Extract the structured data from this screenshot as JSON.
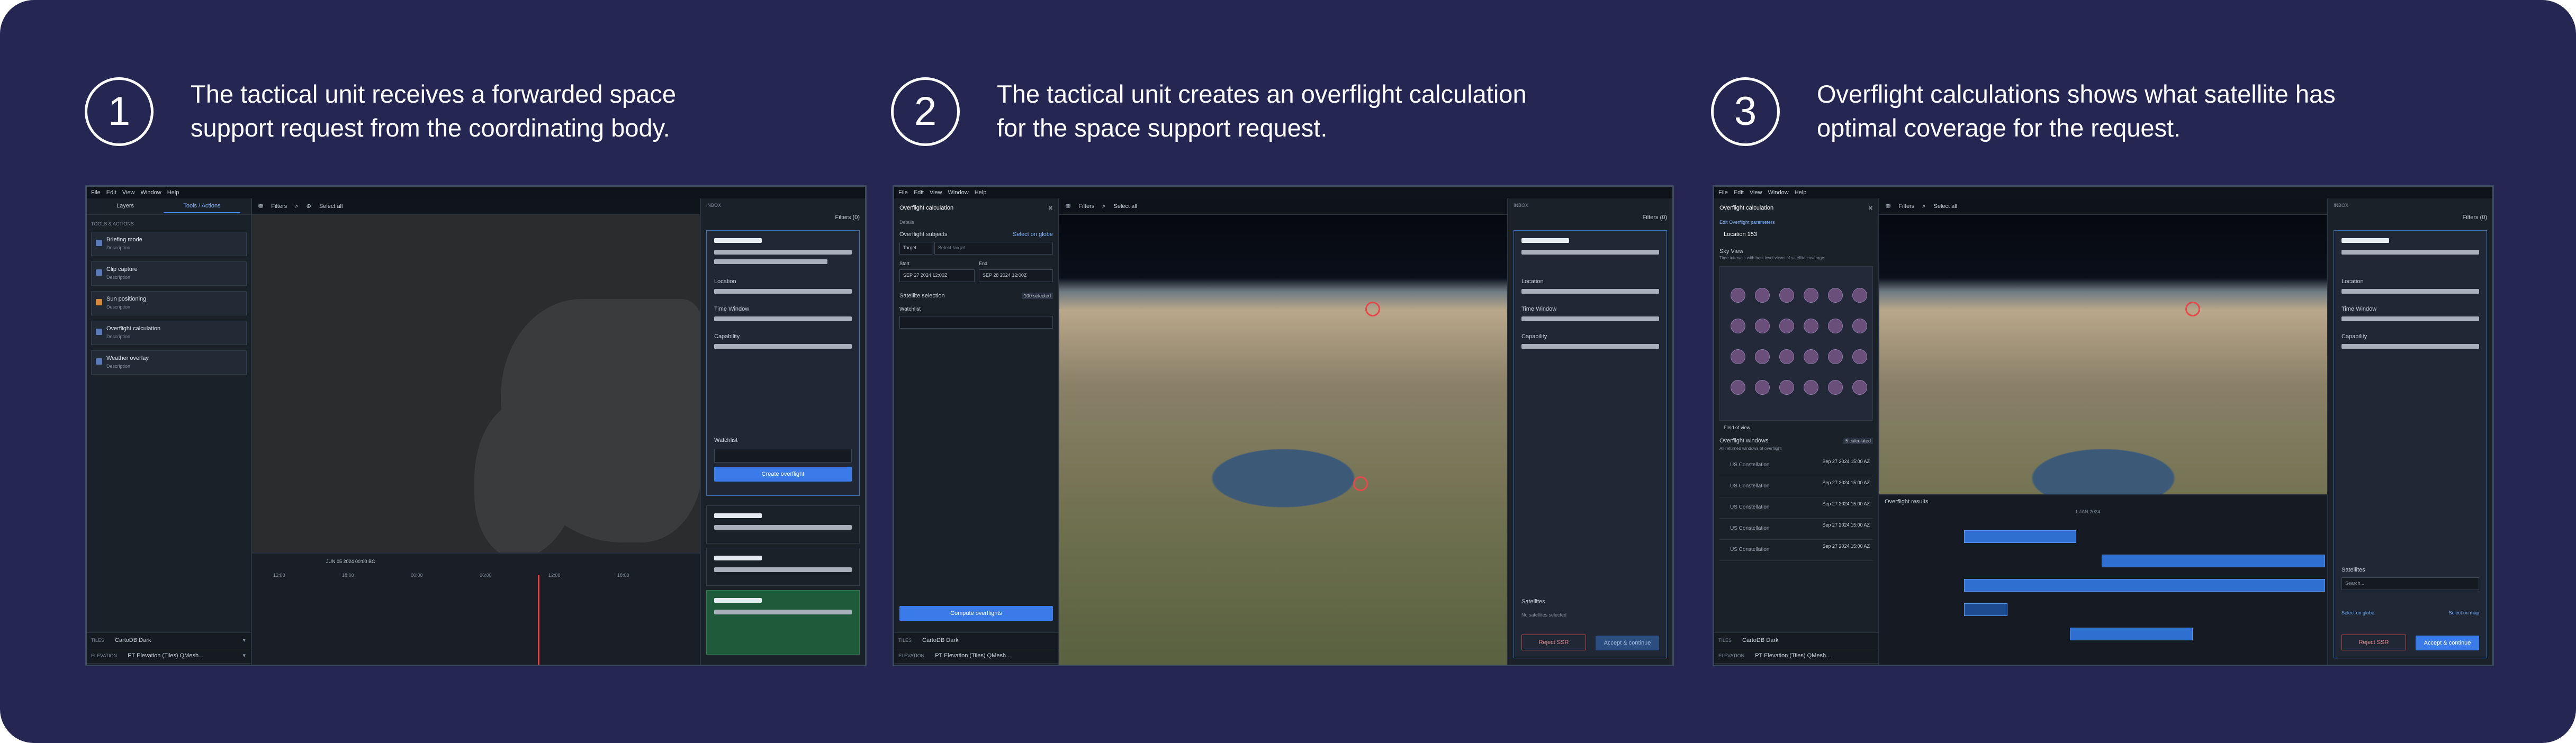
{
  "steps": [
    {
      "number": "1",
      "line1": "The tactical unit receives a forwarded space",
      "line2": "support request from the coordinating body."
    },
    {
      "number": "2",
      "line1": "The tactical unit creates an overflight calculation",
      "line2": "for the space support request."
    },
    {
      "number": "3",
      "line1": "Overflight calculations shows what satellite has",
      "line2": "optimal coverage for the request."
    }
  ],
  "menu": [
    "File",
    "Edit",
    "View",
    "Window",
    "Help"
  ],
  "panel_tabs": [
    "Layers",
    "Tools / Actions"
  ],
  "map_bar": {
    "filters": "Filters",
    "select_all": "Select all"
  },
  "tools_header": "TOOLS & ACTIONS",
  "tools": [
    {
      "title": "Briefing mode",
      "desc": "Description"
    },
    {
      "title": "Clip capture",
      "desc": "Description"
    },
    {
      "title": "Sun positioning",
      "desc": "Description"
    },
    {
      "title": "Overflight calculation",
      "desc": "Description"
    },
    {
      "title": "Weather overlay",
      "desc": "Description"
    }
  ],
  "footer": {
    "tiles_label": "TILES",
    "tiles_value": "CartoDB Dark",
    "elevation_label": "ELEVATION",
    "elevation_value": "PT Elevation (Tiles) QMesh..."
  },
  "right_panel": {
    "header": "INBOX",
    "filters": "Filters (0)",
    "location": "Location",
    "time_window": "Time Window",
    "capability": "Capability",
    "watchlist": "Watchlist",
    "create_overflight": "Create overflight",
    "satellites": "Satellites",
    "no_satellites": "No satellites selected",
    "search": "Search...",
    "select_on_globe": "Select on globe",
    "select_on_map": "Select on map",
    "reject": "Reject SSR",
    "accept": "Accept & continue"
  },
  "overflight_form": {
    "title": "Overflight calculation",
    "details": "Details",
    "subjects": "Overflight subjects",
    "select_on_globe": "Select on globe",
    "target": "Target",
    "select_target": "Select target",
    "start": "Start",
    "start_value": "SEP 27 2024 12:00Z",
    "end": "End",
    "end_value": "SEP 28 2024 12:00Z",
    "satellite_selection": "Satellite selection",
    "selected": "100 selected",
    "watchlist": "Watchlist",
    "compute": "Compute overflights"
  },
  "overflight_result": {
    "title": "Overflight calculation",
    "edit": "Edit Overflight parameters",
    "location": "Location 153",
    "sky_view": "Sky View",
    "sky_desc": "Time intervals with best level views of satellite coverage",
    "field_of_view": "Field of view",
    "windows": "Overflight windows",
    "windows_desc": "All returned windows of overflight",
    "windows_count": "5 calculated",
    "rows": [
      {
        "name": "US Constellation",
        "time": "Sep 27 2024 15:00 AZ"
      },
      {
        "name": "US Constellation",
        "time": "Sep 27 2024 15:00 AZ"
      },
      {
        "name": "US Constellation",
        "time": "Sep 27 2024 15:00 AZ"
      },
      {
        "name": "US Constellation",
        "time": "Sep 27 2024 15:00 AZ"
      },
      {
        "name": "US Constellation",
        "time": "Sep 27 2024 15:00 AZ"
      }
    ],
    "results_label": "Overflight results",
    "timeline_date": "1 JAN 2024"
  },
  "timeline": {
    "date": "JUN 05 2024 00:00 BC",
    "ticks": [
      "12:00",
      "18:00",
      "00:00",
      "06:00",
      "12:00",
      "18:00"
    ]
  },
  "colors": {
    "background": "#262652",
    "accent": "#3b7be9",
    "alert": "#e5484d"
  }
}
